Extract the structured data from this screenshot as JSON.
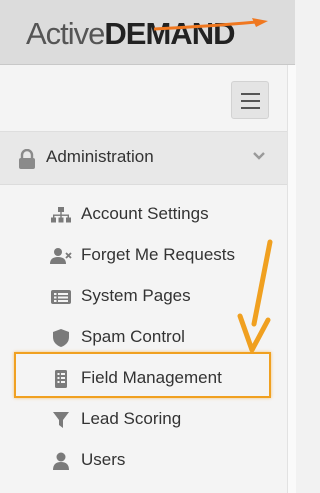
{
  "app": {
    "logo_part1": "Active",
    "logo_part2": "DEMAND"
  },
  "nav": {
    "section_label": "Administration",
    "items": [
      {
        "label": "Account Settings",
        "icon": "sitemap-icon"
      },
      {
        "label": "Forget Me Requests",
        "icon": "user-remove-icon"
      },
      {
        "label": "System Pages",
        "icon": "list-card-icon"
      },
      {
        "label": "Spam Control",
        "icon": "shield-icon"
      },
      {
        "label": "Field Management",
        "icon": "list-icon"
      },
      {
        "label": "Lead Scoring",
        "icon": "filter-icon"
      },
      {
        "label": "Users",
        "icon": "user-icon"
      }
    ]
  },
  "colors": {
    "highlight": "#f0a020",
    "arrow": "#f0a020",
    "logo_accent": "#f07820"
  }
}
